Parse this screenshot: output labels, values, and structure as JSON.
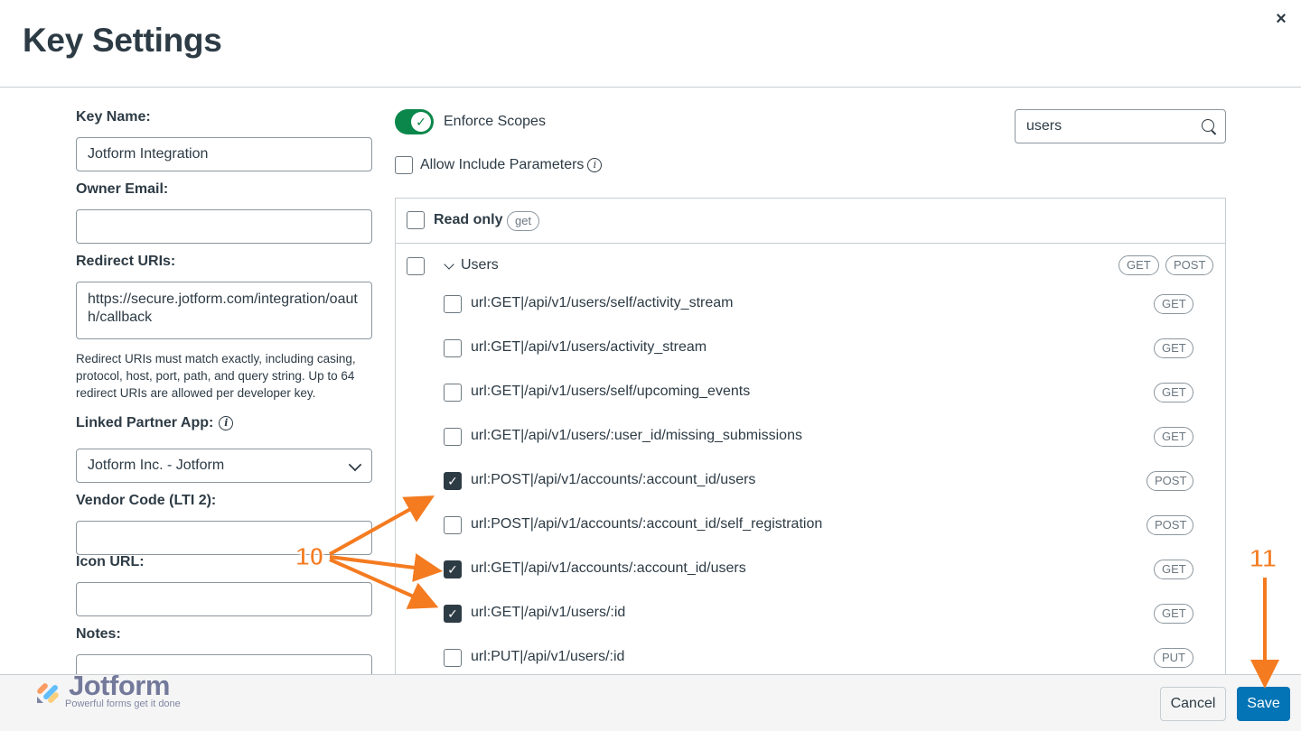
{
  "header": {
    "title": "Key Settings",
    "close_label": "×"
  },
  "form": {
    "key_name": {
      "label": "Key Name:",
      "value": "Jotform Integration"
    },
    "owner_email": {
      "label": "Owner Email:",
      "value": ""
    },
    "redirect_uris": {
      "label": "Redirect URIs:",
      "value": "https://secure.jotform.com/integration/oauth/callback",
      "hint": "Redirect URIs must match exactly, including casing, protocol, host, port, path, and query string. Up to 64 redirect URIs are allowed per developer key."
    },
    "linked_partner_app": {
      "label": "Linked Partner App:",
      "value": "Jotform Inc. - Jotform"
    },
    "vendor_code": {
      "label": "Vendor Code (LTI 2):",
      "value": ""
    },
    "icon_url": {
      "label": "Icon URL:",
      "value": ""
    },
    "notes": {
      "label": "Notes:",
      "value": ""
    }
  },
  "scopes": {
    "enforce_label": "Enforce Scopes",
    "enforce_on": true,
    "allow_include_label": "Allow Include Parameters",
    "search_value": "users",
    "read_only_label": "Read only",
    "read_only_pill": "get",
    "group": {
      "label": "Users",
      "methods": [
        "GET",
        "POST"
      ]
    },
    "items": [
      {
        "text": "url:GET|/api/v1/users/self/activity_stream",
        "method": "GET",
        "checked": false
      },
      {
        "text": "url:GET|/api/v1/users/activity_stream",
        "method": "GET",
        "checked": false
      },
      {
        "text": "url:GET|/api/v1/users/self/upcoming_events",
        "method": "GET",
        "checked": false
      },
      {
        "text": "url:GET|/api/v1/users/:user_id/missing_submissions",
        "method": "GET",
        "checked": false
      },
      {
        "text": "url:POST|/api/v1/accounts/:account_id/users",
        "method": "POST",
        "checked": true
      },
      {
        "text": "url:POST|/api/v1/accounts/:account_id/self_registration",
        "method": "POST",
        "checked": false
      },
      {
        "text": "url:GET|/api/v1/accounts/:account_id/users",
        "method": "GET",
        "checked": true
      },
      {
        "text": "url:GET|/api/v1/users/:id",
        "method": "GET",
        "checked": true
      },
      {
        "text": "url:PUT|/api/v1/users/:id",
        "method": "PUT",
        "checked": false
      }
    ]
  },
  "footer": {
    "cancel_label": "Cancel",
    "save_label": "Save"
  },
  "branding": {
    "logo_text": "Jotform",
    "tagline": "Powerful forms get it done"
  },
  "annotations": {
    "step_a": "10",
    "step_b": "11",
    "color": "#f47b20"
  },
  "icons": {
    "close": "close-icon",
    "search": "search-icon",
    "info": "info-icon",
    "chevron": "chevron-down-icon",
    "check": "check-icon"
  }
}
